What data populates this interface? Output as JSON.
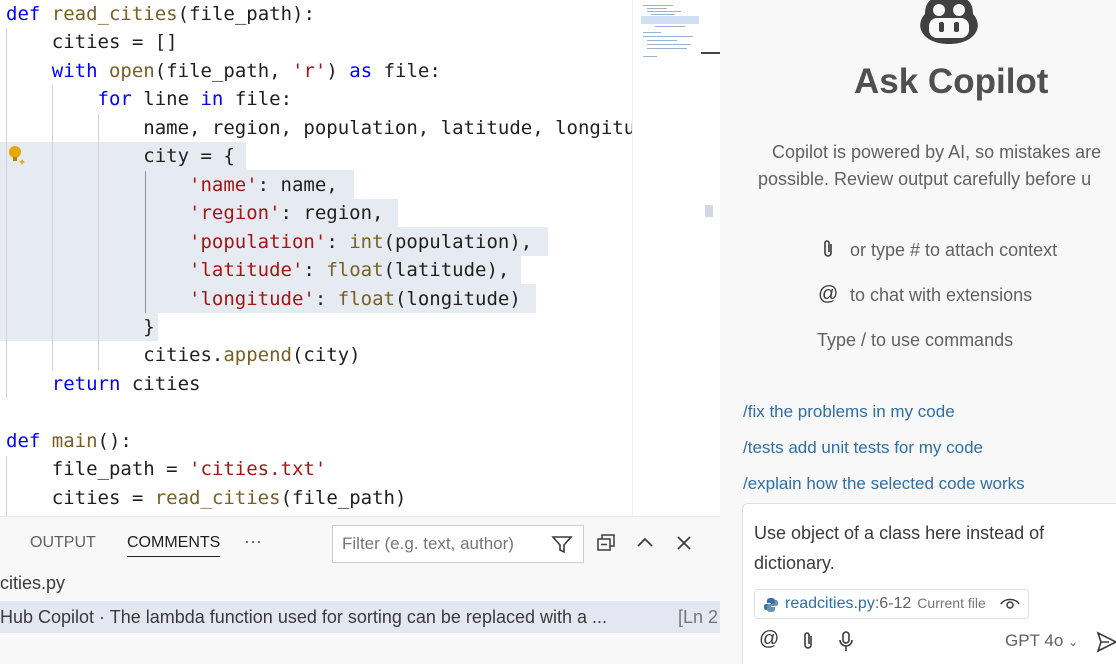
{
  "editor": {
    "lines": [
      [
        [
          "def",
          "kw"
        ],
        [
          " ",
          ""
        ],
        [
          "read_cities",
          "fn"
        ],
        [
          "(file_path):",
          ""
        ]
      ],
      [
        [
          "    cities = []",
          ""
        ]
      ],
      [
        [
          "    ",
          ""
        ],
        [
          "with",
          "kw"
        ],
        [
          " ",
          ""
        ],
        [
          "open",
          "fn"
        ],
        [
          "(file_path, ",
          ""
        ],
        [
          "'r'",
          "st"
        ],
        [
          ") ",
          ""
        ],
        [
          "as",
          "kw"
        ],
        [
          " file:",
          ""
        ]
      ],
      [
        [
          "        ",
          ""
        ],
        [
          "for",
          "kw"
        ],
        [
          " line ",
          ""
        ],
        [
          "in",
          "kw"
        ],
        [
          " file:",
          ""
        ]
      ],
      [
        [
          "            name, region, population, latitude, longitude",
          ""
        ]
      ],
      [
        [
          "            city = {",
          ""
        ]
      ],
      [
        [
          "                ",
          ""
        ],
        [
          "'name'",
          "st"
        ],
        [
          ": name,",
          ""
        ]
      ],
      [
        [
          "                ",
          ""
        ],
        [
          "'region'",
          "st"
        ],
        [
          ": region,",
          ""
        ]
      ],
      [
        [
          "                ",
          ""
        ],
        [
          "'population'",
          "st"
        ],
        [
          ": ",
          ""
        ],
        [
          "int",
          "fn"
        ],
        [
          "(population),",
          ""
        ]
      ],
      [
        [
          "                ",
          ""
        ],
        [
          "'latitude'",
          "st"
        ],
        [
          ": ",
          ""
        ],
        [
          "float",
          "fn"
        ],
        [
          "(latitude),",
          ""
        ]
      ],
      [
        [
          "                ",
          ""
        ],
        [
          "'longitude'",
          "st"
        ],
        [
          ": ",
          ""
        ],
        [
          "float",
          "fn"
        ],
        [
          "(longitude)",
          ""
        ]
      ],
      [
        [
          "            }",
          ""
        ]
      ],
      [
        [
          "            cities.",
          ""
        ],
        [
          "append",
          "fn"
        ],
        [
          "(city)",
          ""
        ]
      ],
      [
        [
          "    ",
          ""
        ],
        [
          "return",
          "kw"
        ],
        [
          " cities",
          ""
        ]
      ],
      [
        [
          "",
          ""
        ]
      ],
      [
        [
          "def",
          "kw"
        ],
        [
          " ",
          ""
        ],
        [
          "main",
          "fn"
        ],
        [
          "():",
          ""
        ]
      ],
      [
        [
          "    file_path = ",
          ""
        ],
        [
          "'cities.txt'",
          "st"
        ]
      ],
      [
        [
          "    cities = ",
          ""
        ],
        [
          "read_cities",
          "fn"
        ],
        [
          "(file_path)",
          ""
        ]
      ]
    ],
    "colors": {
      "keyword": "#0000ff",
      "function": "#795e26",
      "string": "#a31515",
      "selection": "#e5ebf1"
    }
  },
  "panel": {
    "tabs": {
      "output": "OUTPUT",
      "comments": "COMMENTS",
      "more": "···"
    },
    "filter_placeholder": "Filter (e.g. text, author)",
    "icons": [
      "filter-icon",
      "collapse-all-icon",
      "chevron-up-icon",
      "close-icon"
    ],
    "file": "cities.py",
    "comment": {
      "text": "Hub Copilot · The lambda function used for sorting can be replaced with a ...",
      "position": "[Ln 2"
    }
  },
  "copilot": {
    "title": "Ask Copilot",
    "disclaimer_1": "Copilot is powered by AI, so mistakes are",
    "disclaimer_2": "possible. Review output carefully before u",
    "hints": [
      {
        "icon": "paperclip-icon",
        "text": "or type # to attach context"
      },
      {
        "icon": "at-icon",
        "text": "to chat with extensions"
      },
      {
        "icon": "",
        "text": "Type / to use commands"
      }
    ],
    "commands": [
      "/fix the problems in my code",
      "/tests add unit tests for my code",
      "/explain how the selected code works"
    ],
    "input_text": "Use object of a class here instead of dictionary.",
    "context": {
      "file": "readcities.py",
      "range": ":6-12",
      "label": "Current file"
    },
    "model": "GPT 4o",
    "accent": "#2f6fa5"
  }
}
